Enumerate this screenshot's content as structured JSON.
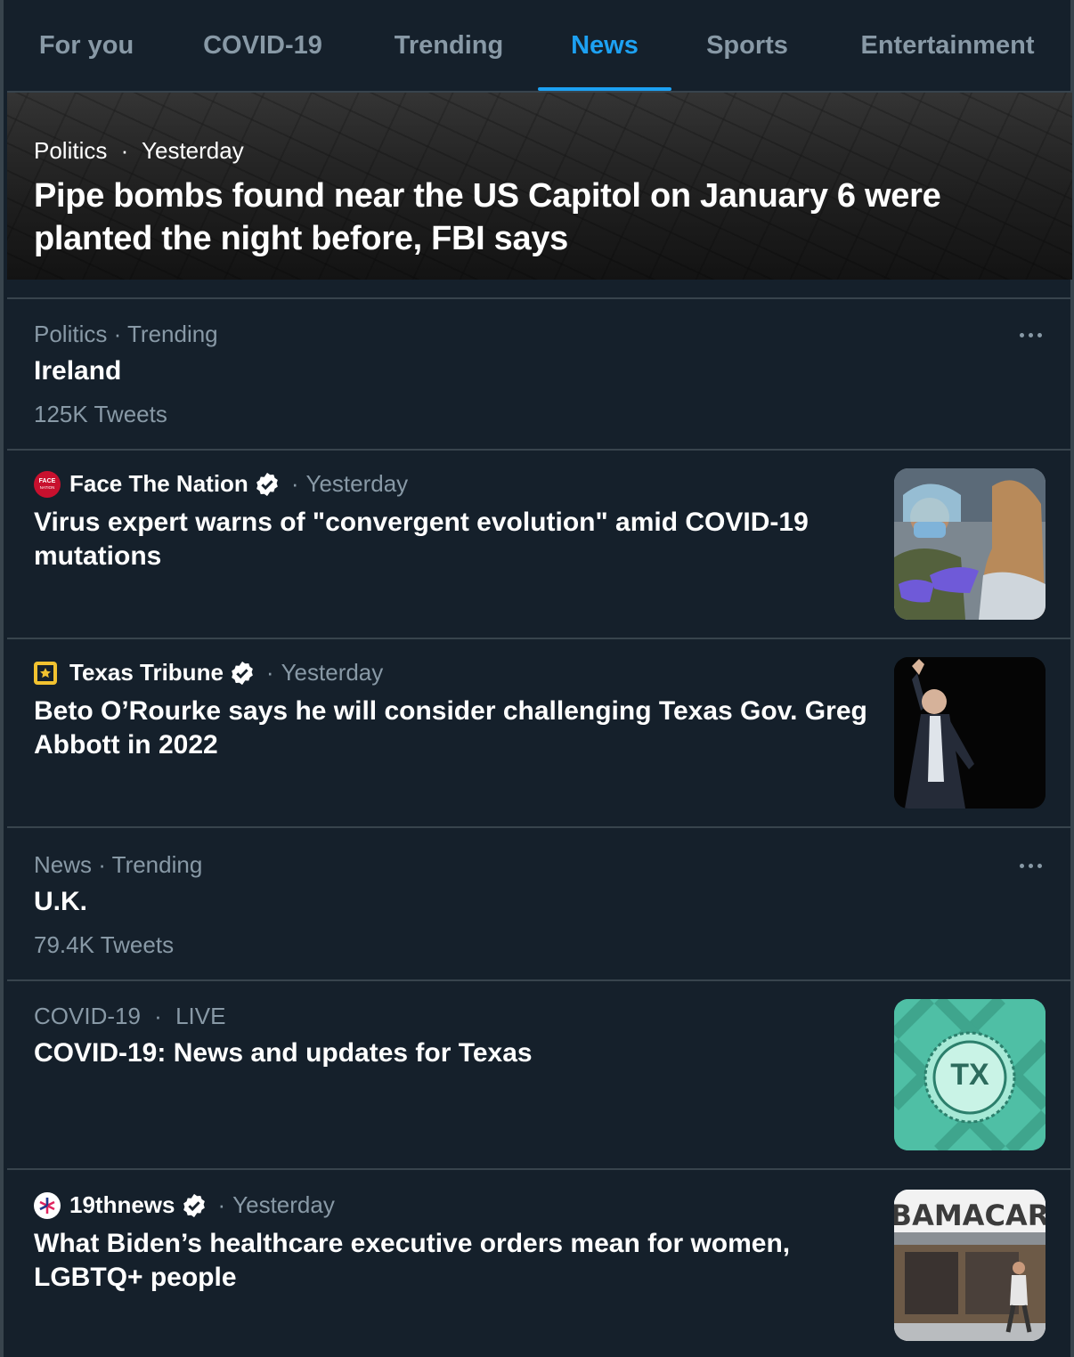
{
  "tabs": [
    {
      "label": "For you"
    },
    {
      "label": "COVID-19"
    },
    {
      "label": "Trending"
    },
    {
      "label": "News"
    },
    {
      "label": "Sports"
    },
    {
      "label": "Entertainment"
    }
  ],
  "active_tab": "News",
  "hero": {
    "category": "Politics",
    "separator": "·",
    "time": "Yesterday",
    "title": "Pipe bombs found near the US Capitol on January 6 were planted the night before, FBI says"
  },
  "items": [
    {
      "type": "trend",
      "meta": "Politics · Trending",
      "title": "Ireland",
      "count": "125K Tweets"
    },
    {
      "type": "news",
      "source": "Face The Nation",
      "separator": "·",
      "time": "Yesterday",
      "title": "Virus expert warns of \"convergent evolution\" amid COVID-19 mutations",
      "logo_text": "FACE NATION",
      "thumb": "vaccination-photo"
    },
    {
      "type": "news",
      "source": "Texas Tribune",
      "separator": "·",
      "time": "Yesterday",
      "title": "Beto O’Rourke says he will consider challenging Texas Gov. Greg Abbott in 2022",
      "thumb": "beto-orourke-photo"
    },
    {
      "type": "trend",
      "meta": "News · Trending",
      "title": "U.K.",
      "count": "79.4K Tweets"
    },
    {
      "type": "event",
      "category": "COVID-19",
      "separator": "·",
      "status": "LIVE",
      "title": "COVID-19: News and updates for Texas",
      "thumb_text": "TX"
    },
    {
      "type": "news",
      "source": "19thnews",
      "separator": "·",
      "time": "Yesterday",
      "title": "What Biden’s healthcare executive orders mean for women, LGBTQ+ people",
      "thumb_text": "BAMACAR"
    }
  ],
  "colors": {
    "background": "#15202b",
    "divider": "#38444d",
    "accent": "#1da1f2",
    "secondary_text": "#8899a6",
    "verified": "#ffffff"
  }
}
